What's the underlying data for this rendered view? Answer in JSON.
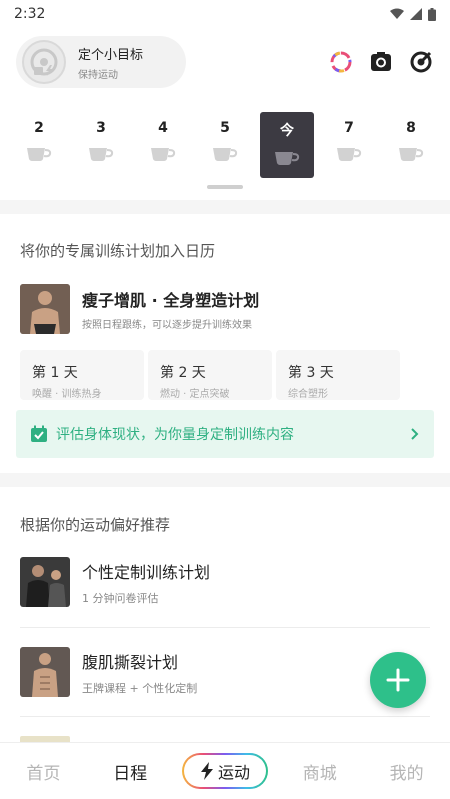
{
  "status_bar": {
    "time": "2:32"
  },
  "header": {
    "goal_title": "定个小目标",
    "goal_subtitle": "保持运动",
    "icons": [
      "ring-icon",
      "camera-icon",
      "target-icon"
    ]
  },
  "week": {
    "days": [
      {
        "label": "2",
        "today": false
      },
      {
        "label": "3",
        "today": false
      },
      {
        "label": "4",
        "today": false
      },
      {
        "label": "5",
        "today": false
      },
      {
        "label": "今",
        "today": true
      },
      {
        "label": "7",
        "today": false
      },
      {
        "label": "8",
        "today": false
      }
    ]
  },
  "plan_section": {
    "title": "将你的专属训练计划加入日历",
    "plan_name": "瘦子增肌 · 全身塑造计划",
    "plan_desc": "按照日程跟练，可以逐步提升训练效果",
    "day_cards": [
      {
        "title": "第 1 天",
        "subtitle": "唤醒 · 训练热身"
      },
      {
        "title": "第 2 天",
        "subtitle": "燃动 · 定点突破"
      },
      {
        "title": "第 3 天",
        "subtitle": "综合塑形"
      }
    ],
    "assess_text": "评估身体现状，为你量身定制训练内容"
  },
  "recommend_section": {
    "title": "根据你的运动偏好推荐",
    "items": [
      {
        "name": "个性定制训练计划",
        "desc": "1 分钟问卷评估"
      },
      {
        "name": "腹肌撕裂计划",
        "desc": "王牌课程 + 个性化定制"
      }
    ]
  },
  "bottom_nav": {
    "home": "首页",
    "schedule": "日程",
    "sport": "运动",
    "mall": "商城",
    "mine": "我的"
  },
  "colors": {
    "accent": "#2ec08a",
    "today_bg": "#3c3a42"
  }
}
